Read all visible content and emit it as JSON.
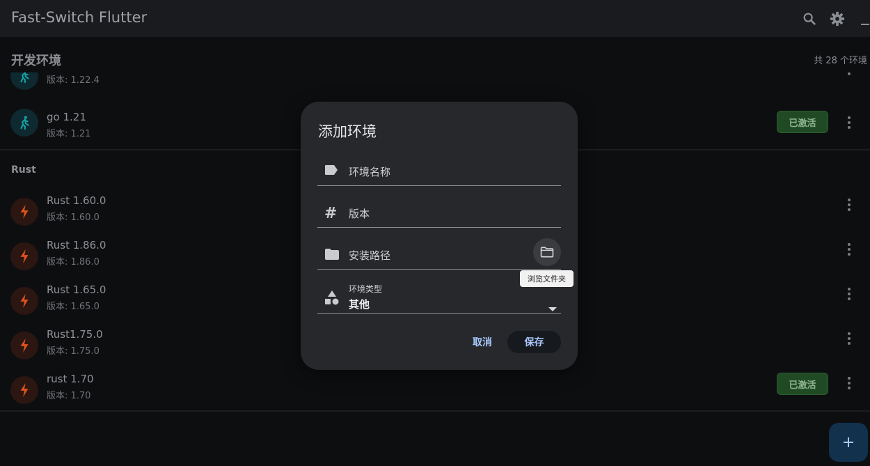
{
  "app": {
    "title": "Fast-Switch Flutter"
  },
  "appbar": {
    "search_icon": "search-icon",
    "settings_icon": "gear-icon",
    "minimize_icon": "minimize-icon"
  },
  "section_dev": {
    "title": "开发环境",
    "count": "共 28 个环境"
  },
  "go_rows": [
    {
      "name": "g",
      "version": "版本: 1.22.4"
    },
    {
      "name": "go 1.21",
      "version": "版本: 1.21",
      "badge": "已激活"
    }
  ],
  "section_rust": {
    "title": "Rust"
  },
  "rust_rows": [
    {
      "name": "Rust 1.60.0",
      "version": "版本: 1.60.0"
    },
    {
      "name": "Rust 1.86.0",
      "version": "版本: 1.86.0"
    },
    {
      "name": "Rust 1.65.0",
      "version": "版本: 1.65.0"
    },
    {
      "name": "Rust1.75.0",
      "version": "版本: 1.75.0"
    },
    {
      "name": "rust 1.70",
      "version": "版本: 1.70",
      "badge": "已激活"
    }
  ],
  "dialog": {
    "title": "添加环境",
    "name_placeholder": "环境名称",
    "version_placeholder": "版本",
    "path_placeholder": "安装路径",
    "browse_tooltip": "浏览文件夹",
    "type_label": "环境类型",
    "type_value": "其他",
    "cancel": "取消",
    "save": "保存"
  },
  "colors": {
    "accent": "#a8c7fa",
    "active_badge": "#1f4a23",
    "go_icon": "#17a2a8",
    "rust_icon": "#e0531c"
  }
}
